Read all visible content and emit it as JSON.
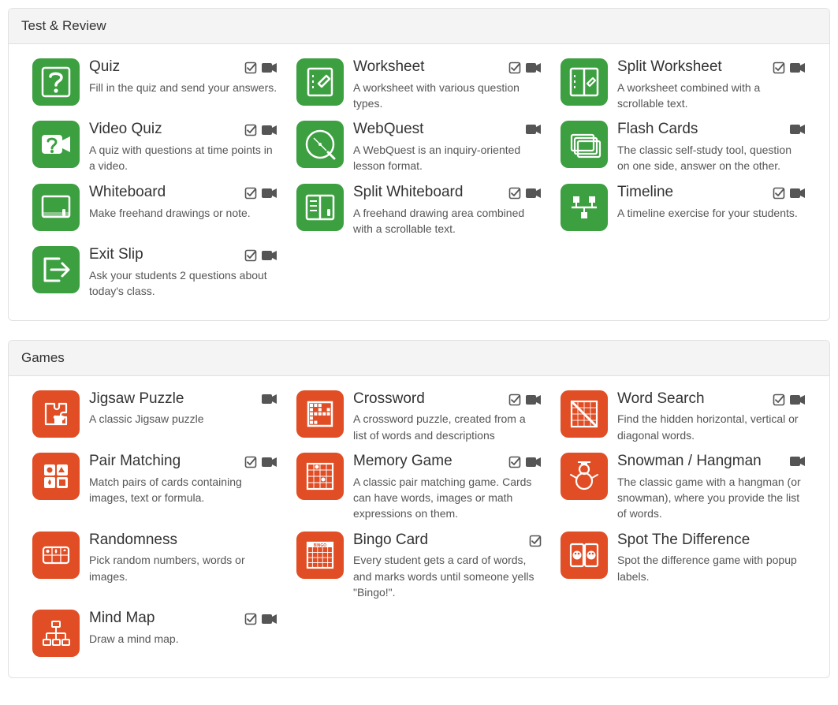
{
  "colors": {
    "green": "#3c9f40",
    "orange": "#e14d24"
  },
  "sections": [
    {
      "title": "Test & Review",
      "color": "green",
      "tiles": [
        {
          "icon": "question",
          "title": "Quiz",
          "desc": "Fill in the quiz and send your answers.",
          "check": true,
          "video": true
        },
        {
          "icon": "worksheet",
          "title": "Worksheet",
          "desc": "A worksheet with various question types.",
          "check": true,
          "video": true
        },
        {
          "icon": "split-sheet",
          "title": "Split Worksheet",
          "desc": "A worksheet combined with a scrollable text.",
          "check": true,
          "video": true
        },
        {
          "icon": "video-quiz",
          "title": "Video Quiz",
          "desc": "A quiz with questions at time points in a video.",
          "check": true,
          "video": true
        },
        {
          "icon": "compass",
          "title": "WebQuest",
          "desc": "A WebQuest is an inquiry-oriented lesson format.",
          "check": false,
          "video": true
        },
        {
          "icon": "flash-cards",
          "title": "Flash Cards",
          "desc": "The classic self-study tool, question on one side, answer on the other.",
          "check": false,
          "video": true
        },
        {
          "icon": "whiteboard",
          "title": "Whiteboard",
          "desc": "Make freehand drawings or note.",
          "check": true,
          "video": true
        },
        {
          "icon": "split-board",
          "title": "Split Whiteboard",
          "desc": "A freehand drawing area combined with a scrollable text.",
          "check": true,
          "video": true
        },
        {
          "icon": "timeline",
          "title": "Timeline",
          "desc": "A timeline exercise for your students.",
          "check": true,
          "video": true
        },
        {
          "icon": "exit",
          "title": "Exit Slip",
          "desc": "Ask your students 2 questions about today's class.",
          "check": true,
          "video": true
        }
      ]
    },
    {
      "title": "Games",
      "color": "orange",
      "tiles": [
        {
          "icon": "jigsaw",
          "title": "Jigsaw Puzzle",
          "desc": "A classic Jigsaw puzzle",
          "check": false,
          "video": true
        },
        {
          "icon": "crossword",
          "title": "Crossword",
          "desc": "A crossword puzzle, created from a list of words and descriptions",
          "check": true,
          "video": true
        },
        {
          "icon": "wordsearch",
          "title": "Word Search",
          "desc": "Find the hidden horizontal, vertical or diagonal words.",
          "check": true,
          "video": true
        },
        {
          "icon": "pairs",
          "title": "Pair Matching",
          "desc": "Match pairs of cards containing images, text or formula.",
          "check": true,
          "video": true
        },
        {
          "icon": "memory",
          "title": "Memory Game",
          "desc": "A classic pair matching game. Cards can have words, images or math expressions on them.",
          "check": true,
          "video": true
        },
        {
          "icon": "snowman",
          "title": "Snowman / Hangman",
          "desc": "The classic game with a hangman (or snowman), where you provide the list of words.",
          "check": false,
          "video": true
        },
        {
          "icon": "random",
          "title": "Randomness",
          "desc": "Pick random numbers, words or images.",
          "check": false,
          "video": false
        },
        {
          "icon": "bingo",
          "title": "Bingo Card",
          "desc": "Every student gets a card of words, and marks words until someone yells \"Bingo!\".",
          "check": true,
          "video": false
        },
        {
          "icon": "spotdiff",
          "title": "Spot The Difference",
          "desc": "Spot the difference game with popup labels.",
          "check": false,
          "video": false
        },
        {
          "icon": "mindmap",
          "title": "Mind Map",
          "desc": "Draw a mind map.",
          "check": true,
          "video": true
        }
      ]
    }
  ]
}
